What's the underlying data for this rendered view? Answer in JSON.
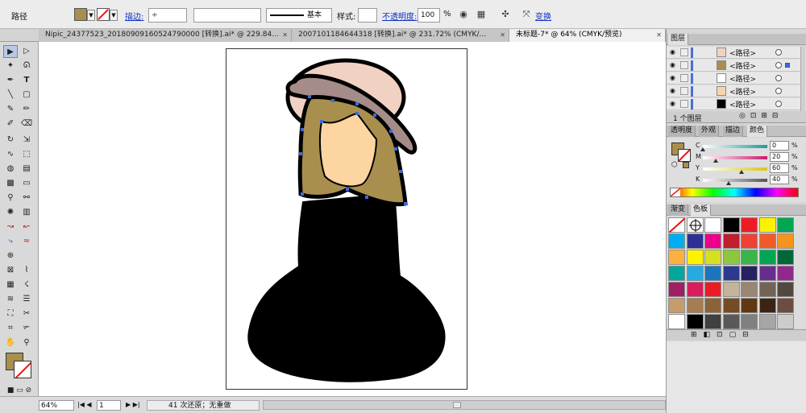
{
  "control_bar": {
    "selection_label": "路径",
    "fill_color": "#a98f4e",
    "stroke_label": "描边:",
    "stroke_profile": "基本",
    "style_label": "样式:",
    "opacity_label": "不透明度:",
    "opacity_value": "100",
    "percent_sign": "%",
    "transform_label": "变换"
  },
  "doc_tabs": [
    {
      "label": "Nipic_24377523_20180909160524790000  [转换].ai* @ 229.84...",
      "active": false
    },
    {
      "label": "2007101184644318  [转换].ai* @ 231.72% (CMYK/...",
      "active": false
    },
    {
      "label": "未标题-7* @ 64% (CMYK/预览)",
      "active": true
    }
  ],
  "tools": {
    "fill_color": "#a98f4e"
  },
  "status_bar": {
    "zoom": "64%",
    "page": "1",
    "history": "41 次还原；无重做"
  },
  "layers_panel": {
    "tab_label": "图层",
    "rows": [
      {
        "name": "<路径>",
        "thumb": "#f1d2c2"
      },
      {
        "name": "<路径>",
        "thumb": "#a98f4e"
      },
      {
        "name": "<路径>",
        "thumb": "#ffffff"
      },
      {
        "name": "<路径>",
        "thumb": "#f8d5a8"
      },
      {
        "name": "<路径>",
        "thumb": "#000000"
      }
    ],
    "layer_count": "1 个图层"
  },
  "color_panel": {
    "tabs": [
      "透明度",
      "外观",
      "描边",
      "颜色"
    ],
    "fill_color": "#a98f4e",
    "channels": [
      {
        "label": "C",
        "value": "0",
        "color": "#1b9c9c",
        "knob": 0.0
      },
      {
        "label": "M",
        "value": "20",
        "color": "#c81a6a",
        "knob": 0.2
      },
      {
        "label": "Y",
        "value": "60",
        "color": "#d8c818",
        "knob": 0.6
      },
      {
        "label": "K",
        "value": "40",
        "color": "#555555",
        "knob": 0.4
      }
    ],
    "percent_sign": "%"
  },
  "swatches_panel": {
    "tabs": [
      "渐变",
      "色板"
    ],
    "rows": [
      [
        "#ffffff",
        "#ffffff",
        "#ffffff",
        "#000000",
        "#ed1c24",
        "#fff200",
        "#00a651"
      ],
      [
        "#00aeef",
        "#2e3192",
        "#ec008c",
        "#be1e2d",
        "#ef4136",
        "#f15a29",
        "#f7941d"
      ],
      [
        "#fbb040",
        "#fff200",
        "#d7df23",
        "#8dc63f",
        "#39b54a",
        "#00a651",
        "#006838"
      ],
      [
        "#00a79d",
        "#27aae1",
        "#1c75bc",
        "#2b3990",
        "#262262",
        "#662d91",
        "#92278f"
      ],
      [
        "#9e1f63",
        "#da1c5c",
        "#ed1c24",
        "#c2b59b",
        "#998675",
        "#736357",
        "#534741"
      ],
      [
        "#c69c6d",
        "#a67c52",
        "#8c6239",
        "#754c24",
        "#603913",
        "#3c2415",
        "#6d4c41"
      ],
      [
        "#ffffff",
        "#000000",
        "#404040",
        "#595959",
        "#808080",
        "#a6a6a6",
        "#cccccc"
      ]
    ]
  }
}
